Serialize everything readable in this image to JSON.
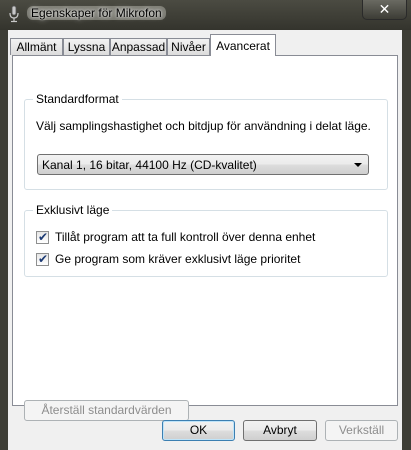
{
  "window": {
    "title": "Egenskaper för Mikrofon",
    "close_glyph": "✕",
    "icon": "microphone-icon"
  },
  "tabs": [
    {
      "label": "Allmänt",
      "active": false
    },
    {
      "label": "Lyssna",
      "active": false
    },
    {
      "label": "Anpassad",
      "active": false
    },
    {
      "label": "Nivåer",
      "active": false
    },
    {
      "label": "Avancerat",
      "active": true
    }
  ],
  "default_format": {
    "heading": "Standardformat",
    "description": "Välj samplingshastighet och bitdjup för användning i delat läge.",
    "selected": "Kanal 1, 16 bitar, 44100 Hz (CD-kvalitet)"
  },
  "exclusive_mode": {
    "heading": "Exklusivt läge",
    "options": [
      {
        "label": "Tillåt program att ta full kontroll över denna enhet",
        "checked": true
      },
      {
        "label": "Ge program som kräver exklusivt läge prioritet",
        "checked": true
      }
    ]
  },
  "restore_defaults_label": "Återställ standardvärden",
  "footer": {
    "ok": "OK",
    "cancel": "Avbryt",
    "apply": "Verkställ"
  },
  "colors": {
    "frame": "#3e3e36",
    "dialog_bg": "#f0f0f0",
    "panel_bg": "#ffffff",
    "disabled_text": "#8d8d8d"
  }
}
